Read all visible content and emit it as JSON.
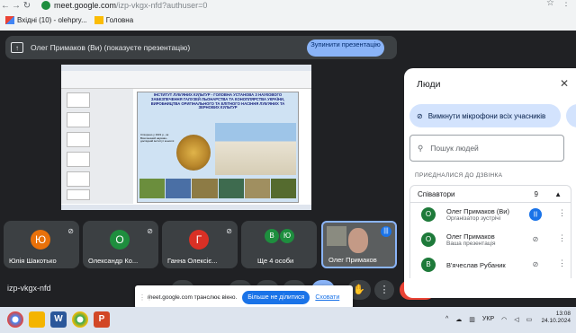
{
  "browser": {
    "url_host": "meet.google.com",
    "url_path": "/izp-vkgx-nfd?authuser=0",
    "bookmarks": [
      {
        "label": "Вхідні (10) - olehpry...",
        "icon": "gmail-icon"
      },
      {
        "label": "Головна",
        "icon": "drive-folder-icon"
      }
    ]
  },
  "presentation": {
    "banner_text": "Олег Примаков (Ви) (показуєте презентацію)",
    "stop_button": "Зупинити презентацію"
  },
  "slide": {
    "header": "ІНСТИТУТ ЛУБ'ЯНИХ КУЛЬТУР - ГОЛОВНА УСТАНОВА З НАУКОВОГО ЗАБЕЗПЕЧЕННЯ ГАЛУЗЕЙ ЛЬОНАРСТВА ТА КОНОПЛЯРСТВА УКРАЇНИ, ВИРОБНИЦТВА ОРИГІНАЛЬНОГО ТА ЕЛІТНОГО НАСІННЯ ЛУБ'ЯНИХ ТА ЗЕРНОВИХ КУЛЬТУР",
    "caption": "Створено у 1931 р., як Всесоюзний науково-дослідний інститут коноплі"
  },
  "participants": [
    {
      "initial": "Ю",
      "name": "Юлія Шакотько",
      "color": "#e8710a",
      "muted": true
    },
    {
      "initial": "О",
      "name": "Олександр Ко...",
      "color": "#1e8e3e",
      "muted": true
    },
    {
      "initial": "Г",
      "name": "Ганна Олексіє...",
      "color": "#d93025",
      "muted": true
    },
    {
      "initial": "",
      "name": "Ще 4 особи",
      "color": "",
      "muted": false
    }
  ],
  "more_avatars": [
    "В",
    "Ю"
  ],
  "self_tile_name": "Олег Примаков",
  "meeting_code": "izp-vkgx-nfd",
  "people_count_badge": "9",
  "panel": {
    "title": "Люди",
    "mute_all": "Вимкнути мікрофони всіх учасників",
    "search_placeholder": "Пошук людей",
    "section": "ПРИЄДНАЛИСЯ ДО ДЗВІНКА",
    "group_label": "Співавтори",
    "group_count": "9",
    "people": [
      {
        "initial": "О",
        "name": "Олег Примаков (Ви)",
        "sub": "Організатор зустрічі",
        "speaking": true
      },
      {
        "initial": "О",
        "name": "Олег Примаков",
        "sub": "Ваша презентація",
        "speaking": false
      },
      {
        "initial": "В",
        "name": "В'ячеслав Рубаник",
        "sub": "",
        "speaking": false
      }
    ]
  },
  "toast": {
    "text": "meet.google.com транслює вікно.",
    "stop": "Більше не ділитися",
    "hide": "Сховати"
  },
  "taskbar": {
    "lang": "УКР",
    "time": "13:08",
    "date": "24.10.2024"
  }
}
